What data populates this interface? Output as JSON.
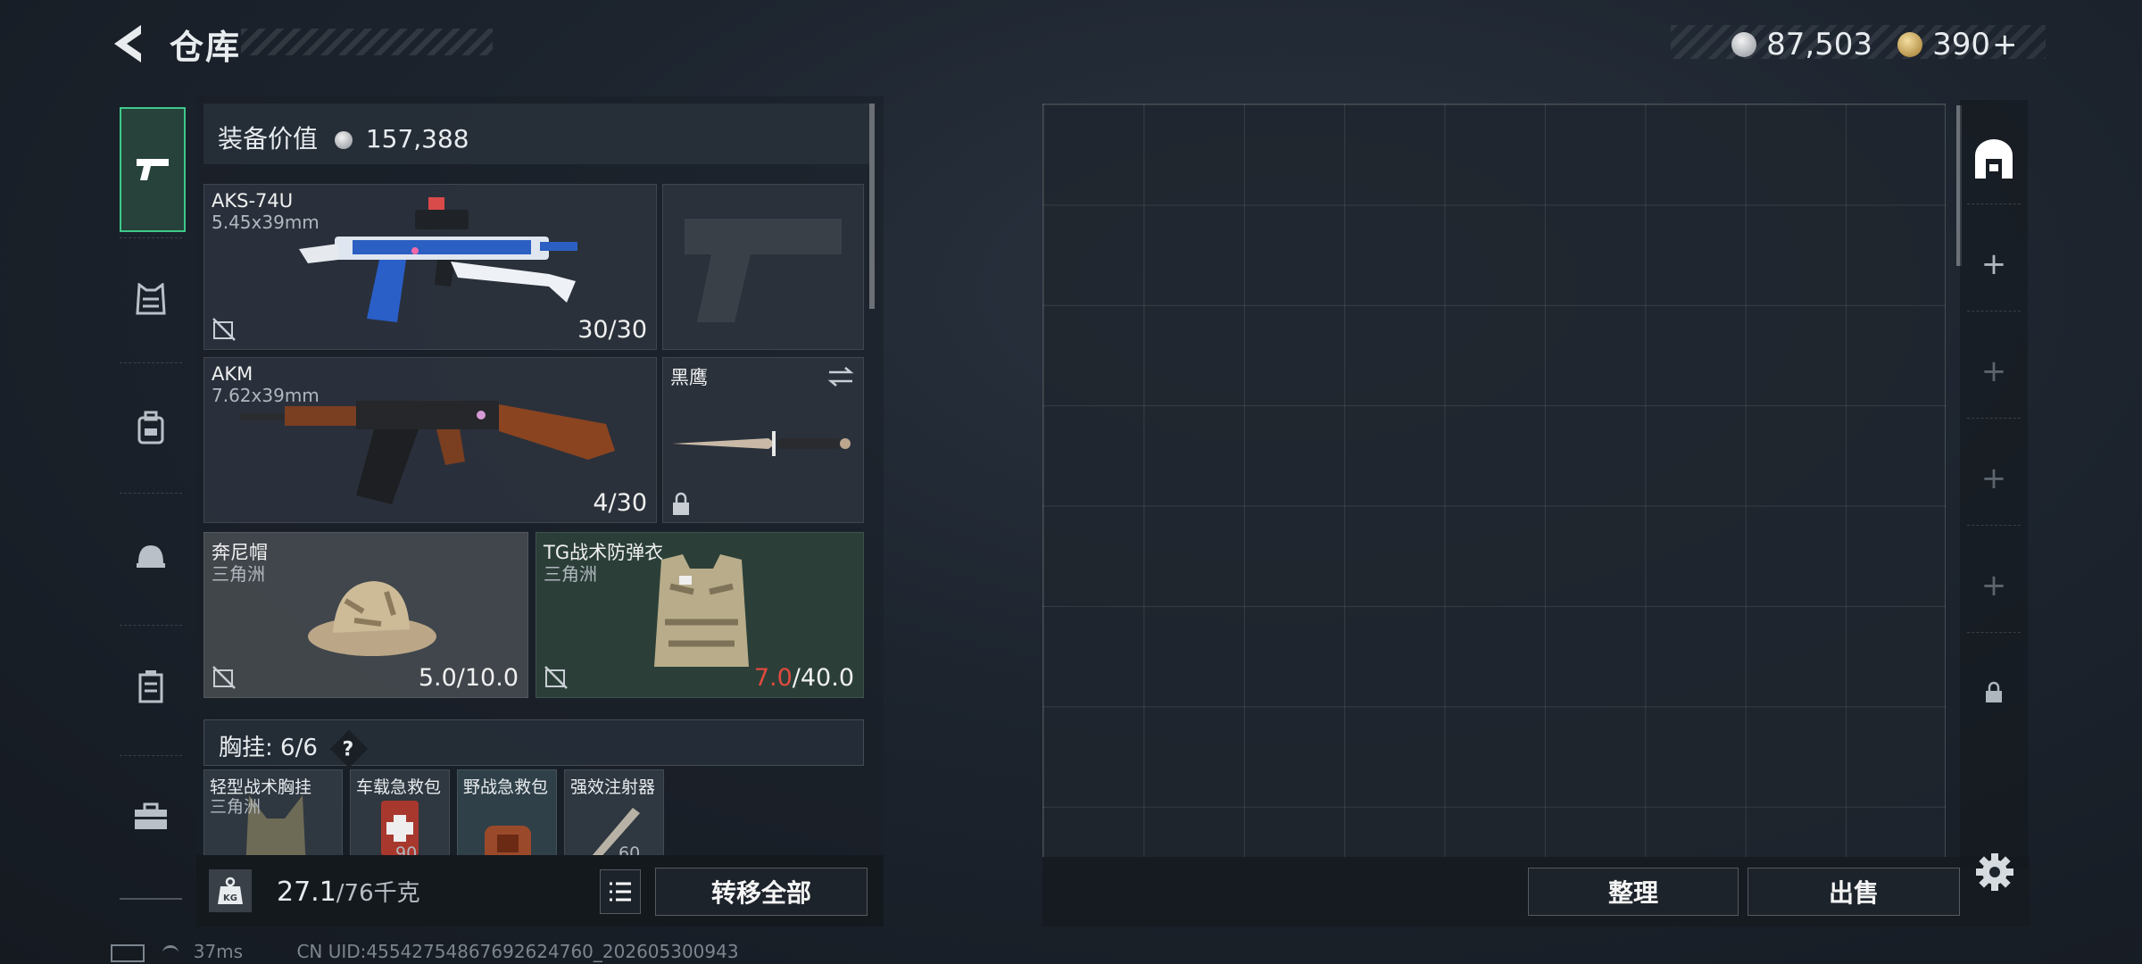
{
  "header": {
    "title": "仓库",
    "silver": "87,503",
    "gold": "390",
    "plus": "+"
  },
  "loadout": {
    "value_label": "装备价值",
    "value": "157,388",
    "primary": {
      "name": "AKS-74U",
      "ammo": "5.45x39mm",
      "count": "30/30"
    },
    "secondary": {
      "name": "AKM",
      "ammo": "7.62x39mm",
      "count": "4/30"
    },
    "melee": {
      "name": "黑鹰"
    },
    "helmet": {
      "name": "奔尼帽",
      "faction": "三角洲",
      "dur": "5.0/10.0"
    },
    "armor": {
      "name": "TG战术防弹衣",
      "faction": "三角洲",
      "dur_cur": "7.0",
      "dur_max": "/40.0"
    },
    "rig": {
      "label": "胸挂:",
      "count": "6/6",
      "help": "?"
    },
    "rig_items": [
      {
        "name": "轻型战术胸挂",
        "sub": "三角洲"
      },
      {
        "name": "车载急救包",
        "sub": "90"
      },
      {
        "name": "野战急救包",
        "sub": ""
      },
      {
        "name": "强效注射器",
        "sub": "60"
      }
    ]
  },
  "bottom": {
    "weight_cur": "27.1",
    "weight_max": "/76千克",
    "transfer": "转移全部",
    "sort": "整理",
    "sell": "出售",
    "kg": "KG"
  },
  "status": {
    "ping": "37ms",
    "uid": "CN UID:4554275486769262476​0_202605300943"
  },
  "colors": {
    "accent": "#3ec98a",
    "danger": "#e04a3e"
  },
  "icons": [
    "back-icon",
    "pistol-icon",
    "vest-icon",
    "backpack-icon",
    "helmet-icon",
    "case-icon",
    "toolbox-icon",
    "safe-icon",
    "plus-icon",
    "lock-icon",
    "settings-icon",
    "list-icon",
    "weight-icon",
    "no-drop-icon",
    "swap-icon",
    "silver-coin-icon",
    "gold-coin-icon"
  ]
}
